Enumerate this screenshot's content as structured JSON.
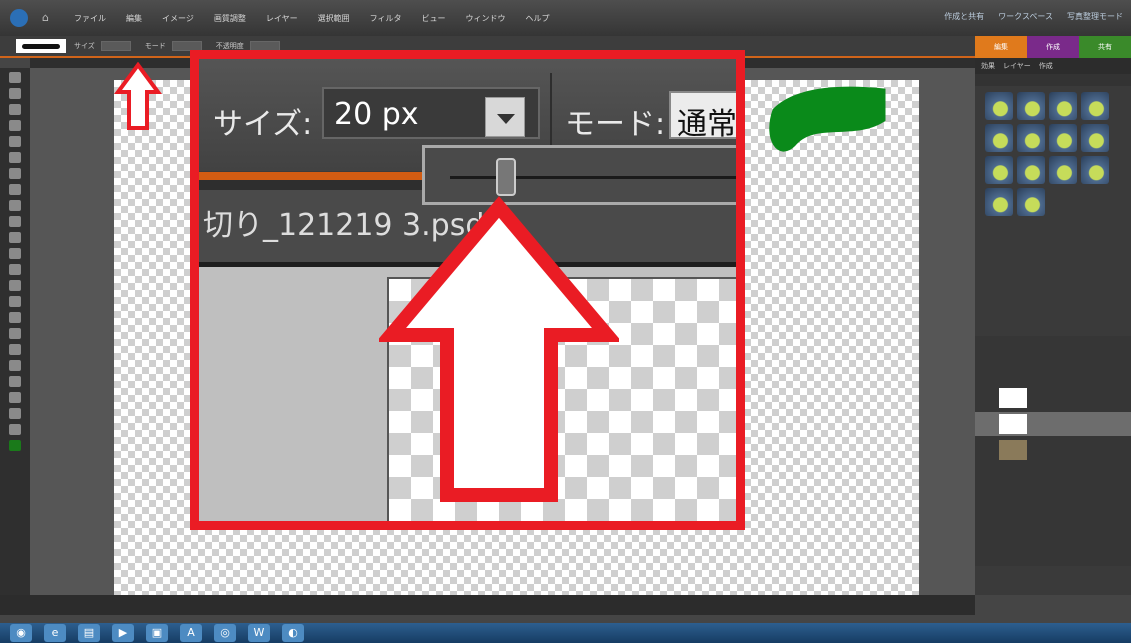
{
  "menubar": {
    "items": [
      "ファイル",
      "編集",
      "イメージ",
      "画質調整",
      "レイヤー",
      "選択範囲",
      "フィルタ",
      "ビュー",
      "ウィンドウ",
      "ヘルプ"
    ],
    "right": [
      "作成と共有",
      "ワークスペース",
      "写真整理モード"
    ]
  },
  "options": {
    "size_label": "サイズ",
    "mode_label": "モード",
    "opacity_label": "不透明度"
  },
  "zoom": {
    "size_label": "サイズ:",
    "size_value": "20 px",
    "mode_label": "モード:",
    "mode_value": "通常",
    "doc_tab": "切り_121219 3.psd"
  },
  "panel": {
    "tabs": [
      "編集",
      "作成",
      "共有"
    ],
    "subtabs": [
      "効果",
      "レイヤー",
      "作成"
    ]
  },
  "colors": {
    "highlight_frame": "#ea1c24",
    "accent_orange": "#d0641a"
  }
}
